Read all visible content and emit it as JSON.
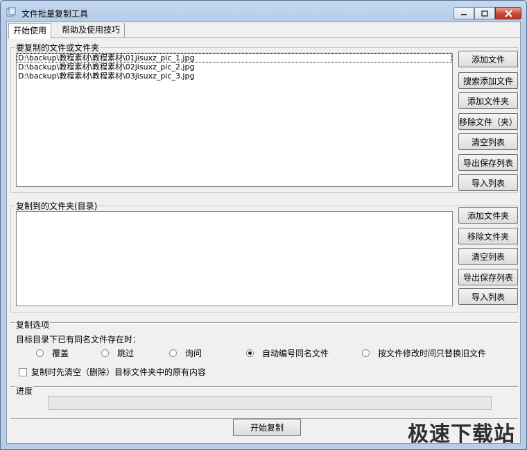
{
  "window": {
    "title": "文件批量复制工具"
  },
  "tabs": [
    {
      "label": "开始使用"
    },
    {
      "label": "帮助及使用技巧"
    }
  ],
  "source": {
    "label": "要复制的文件或文件夹",
    "files": [
      "D:\\backup\\教程素材\\教程素材\\01jisuxz_pic_1.jpg",
      "D:\\backup\\教程素材\\教程素材\\02jisuxz_pic_2.jpg",
      "D:\\backup\\教程素材\\教程素材\\03jisuxz_pic_3.jpg"
    ],
    "buttons": {
      "add_file": "添加文件",
      "search_add": "搜索添加文件",
      "add_folder": "添加文件夹",
      "remove": "移除文件（夹）",
      "clear": "清空列表",
      "export": "导出保存列表",
      "import": "导入列表"
    }
  },
  "dest": {
    "label": "复制到的文件夹(目录)",
    "buttons": {
      "add_folder": "添加文件夹",
      "remove_folder": "移除文件夹",
      "clear": "清空列表",
      "export": "导出保存列表",
      "import": "导入列表"
    }
  },
  "options": {
    "label": "复制选项",
    "prompt": "目标目录下已有同名文件存在时：",
    "radios": [
      {
        "label": "覆盖",
        "checked": false
      },
      {
        "label": "跳过",
        "checked": false
      },
      {
        "label": "询问",
        "checked": false
      },
      {
        "label": "自动编号同名文件",
        "checked": true
      },
      {
        "label": "按文件修改时间只替换旧文件",
        "checked": false
      }
    ],
    "clear_first": {
      "label": "复制时先清空（删除）目标文件夹中的原有内容",
      "checked": false
    }
  },
  "progress": {
    "label": "进度",
    "value": 0
  },
  "start_button": "开始复制",
  "watermark": "极速下载站"
}
